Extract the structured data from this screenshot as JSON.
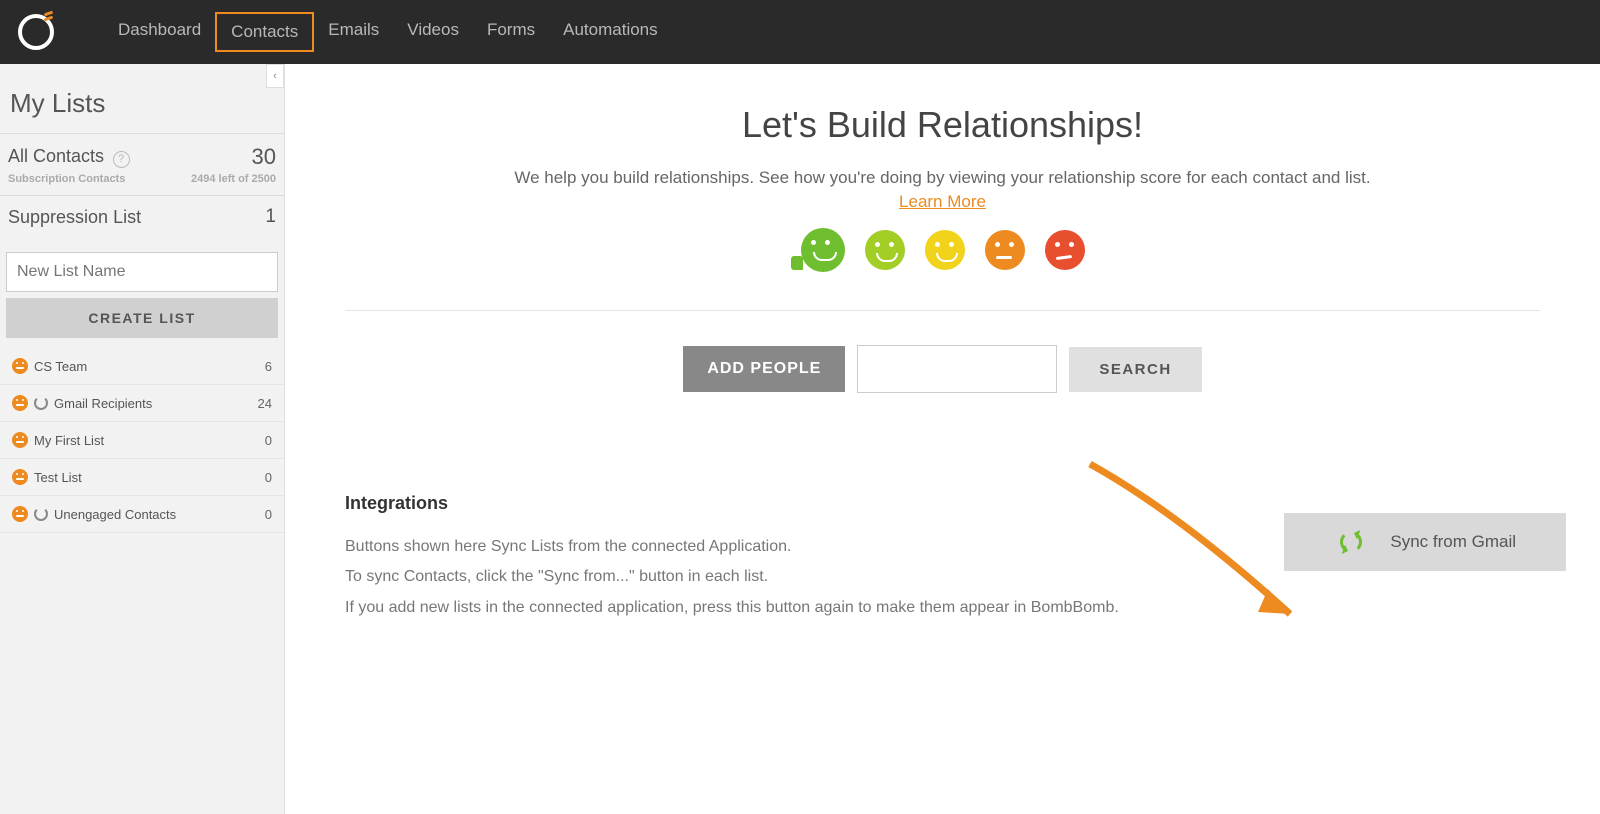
{
  "nav": {
    "items": [
      "Dashboard",
      "Contacts",
      "Emails",
      "Videos",
      "Forms",
      "Automations"
    ],
    "activeIndex": 1
  },
  "sidebar": {
    "title": "My Lists",
    "allContacts": {
      "label": "All Contacts",
      "count": "30",
      "subLabel": "Subscription Contacts",
      "remaining": "2494 left of 2500"
    },
    "suppression": {
      "label": "Suppression List",
      "count": "1"
    },
    "newListPlaceholder": "New List Name",
    "createListLabel": "CREATE LIST",
    "lists": [
      {
        "label": "CS Team",
        "count": "6",
        "spinner": false
      },
      {
        "label": "Gmail Recipients",
        "count": "24",
        "spinner": true
      },
      {
        "label": "My First List",
        "count": "0",
        "spinner": false
      },
      {
        "label": "Test List",
        "count": "0",
        "spinner": false
      },
      {
        "label": "Unengaged Contacts",
        "count": "0",
        "spinner": true
      }
    ]
  },
  "main": {
    "heroTitle": "Let's Build Relationships!",
    "heroSub": "We help you build relationships. See how you're doing by viewing your relationship score for each contact and list.",
    "learnMore": "Learn More",
    "addPeople": "ADD PEOPLE",
    "search": "SEARCH",
    "integrations": {
      "title": "Integrations",
      "line1": "Buttons shown here Sync Lists from the connected Application.",
      "line2": "To sync Contacts, click the \"Sync from...\" button in each list.",
      "line3": "If you add new lists in the connected application, press this button again to make them appear in BombBomb.",
      "syncLabel": "Sync from Gmail"
    }
  }
}
